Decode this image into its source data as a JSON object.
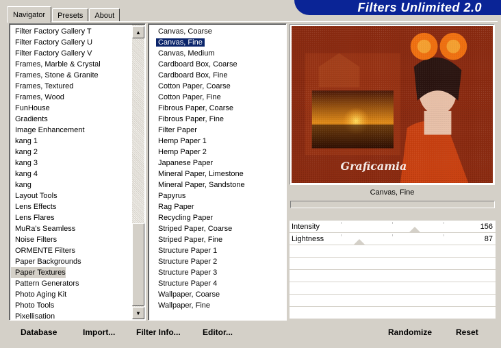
{
  "tabs": [
    {
      "label": "Navigator",
      "active": true
    },
    {
      "label": "Presets",
      "active": false
    },
    {
      "label": "About",
      "active": false
    }
  ],
  "banner_title": "Filters Unlimited 2.0",
  "categories": [
    "Filter Factory Gallery T",
    "Filter Factory Gallery U",
    "Filter Factory Gallery V",
    "Frames, Marble & Crystal",
    "Frames, Stone & Granite",
    "Frames, Textured",
    "Frames, Wood",
    "FunHouse",
    "Gradients",
    "Image Enhancement",
    "kang 1",
    "kang 2",
    "kang 3",
    "kang 4",
    "kang",
    "Layout Tools",
    "Lens Effects",
    "Lens Flares",
    "MuRa's Seamless",
    "Noise Filters",
    "ORMENTE Filters",
    "Paper Backgrounds",
    "Paper Textures",
    "Pattern Generators",
    "Photo Aging Kit",
    "Photo Tools",
    "Pixellisation"
  ],
  "selected_category": "Paper Textures",
  "filters": [
    "Canvas, Coarse",
    "Canvas, Fine",
    "Canvas, Medium",
    "Cardboard Box, Coarse",
    "Cardboard Box, Fine",
    "Cotton Paper, Coarse",
    "Cotton Paper, Fine",
    "Fibrous Paper, Coarse",
    "Fibrous Paper, Fine",
    "Filter Paper",
    "Hemp Paper 1",
    "Hemp Paper 2",
    "Japanese Paper",
    "Mineral Paper, Limestone",
    "Mineral Paper, Sandstone",
    "Papyrus",
    "Rag Paper",
    "Recycling Paper",
    "Striped Paper, Coarse",
    "Striped Paper, Fine",
    "Structure Paper 1",
    "Structure Paper 2",
    "Structure Paper 3",
    "Structure Paper 4",
    "Wallpaper, Coarse",
    "Wallpaper, Fine"
  ],
  "selected_filter": "Canvas, Fine",
  "preview": {
    "filter_name": "Canvas, Fine",
    "watermark": "Graficamia"
  },
  "sliders": [
    {
      "label": "Intensity",
      "value": "156",
      "level": 0.61
    },
    {
      "label": "Lightness",
      "value": "87",
      "level": 0.34
    }
  ],
  "buttons": {
    "database": "Database",
    "import": "Import...",
    "filter_info": "Filter Info...",
    "editor": "Editor...",
    "randomize": "Randomize",
    "reset": "Reset"
  },
  "colors": {
    "banner": "#0a2496",
    "selection": "#0a246a",
    "face": "#d4d0c8"
  }
}
